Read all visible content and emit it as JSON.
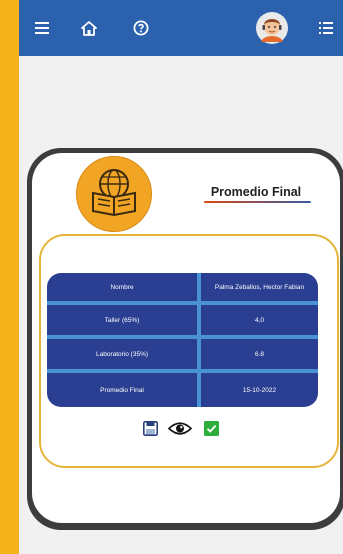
{
  "colors": {
    "primary": "#2b61ad",
    "accent": "#f6b21a",
    "table_bg": "#2b3f92",
    "table_sep": "#4a93d2"
  },
  "header": {
    "menu_icon": "hamburger-menu-icon",
    "home_icon": "home-icon",
    "help_icon": "help-circle-icon",
    "avatar_icon": "user-avatar-icon",
    "list_icon": "list-icon"
  },
  "card": {
    "logo_icon": "book-globe-logo-icon",
    "title": "Promedio Final"
  },
  "table": {
    "rows": [
      {
        "label": "Nombre",
        "value": "Palma Zeballos, Hector Fabian"
      },
      {
        "label": "Taller (65%)",
        "value": "4,0"
      },
      {
        "label": "Laboratorio (35%)",
        "value": "6.8"
      },
      {
        "label": "Promedio Final",
        "value": "15-10-2022"
      }
    ]
  },
  "actions": {
    "save_icon": "save-icon",
    "view_icon": "eye-icon",
    "confirm_icon": "checkmark-icon"
  }
}
